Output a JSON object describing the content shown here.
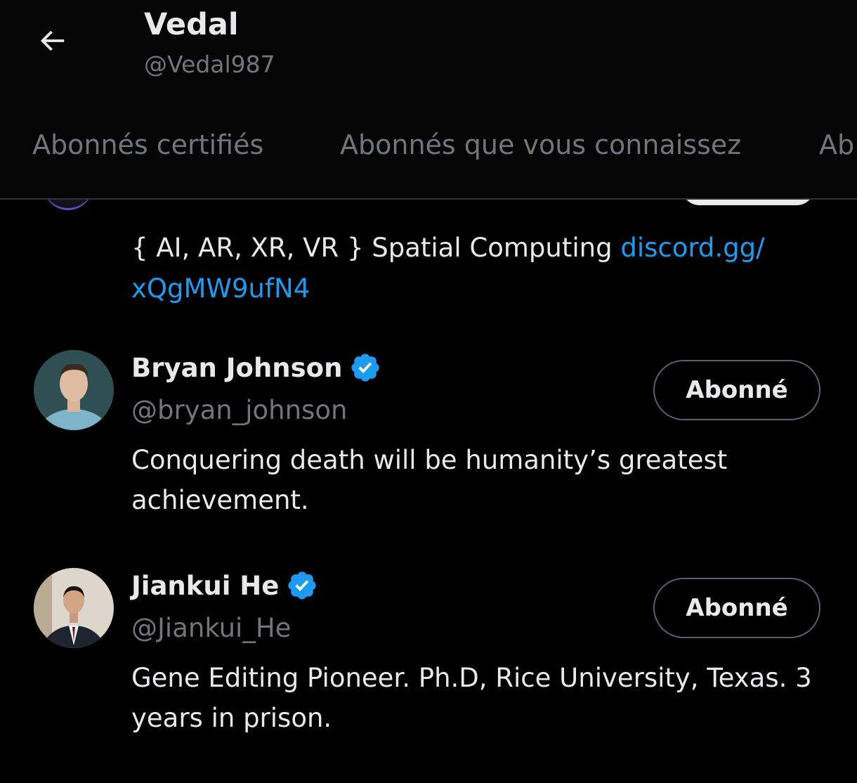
{
  "header": {
    "back_icon": "arrow-left-icon",
    "name": "Vedal",
    "handle": "@Vedal987"
  },
  "tabs": [
    {
      "label": "Abonnés certifiés"
    },
    {
      "label": "Abonnés que vous connaissez"
    },
    {
      "label": "Ab"
    }
  ],
  "peek_item": {
    "bio_text": "{ AI, AR, XR, VR } Spatial Computing ",
    "bio_link": "discord.gg/ xQgMW9ufN4"
  },
  "users": [
    {
      "name": "Bryan Johnson",
      "verified": true,
      "handle": "@bryan_johnson",
      "bio": "Conquering death will be humanity’s greatest achievement.",
      "follow_label": "Abonné"
    },
    {
      "name": "Jiankui He",
      "verified": true,
      "handle": "@Jiankui_He",
      "bio": "Gene Editing Pioneer. Ph.D, Rice University, Texas. 3 years in prison.",
      "follow_label": "Abonné"
    }
  ],
  "colors": {
    "background": "#000000",
    "text_primary": "#e7e9ea",
    "text_secondary": "#71767b",
    "link": "#1d9bf0",
    "verified": "#1d9bf0",
    "button_border": "#536471"
  }
}
